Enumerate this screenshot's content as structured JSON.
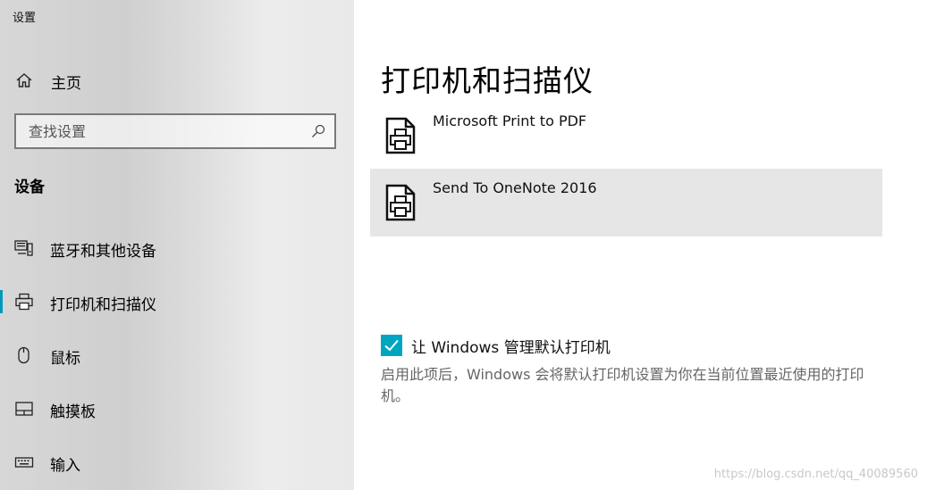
{
  "window": {
    "title": "设置"
  },
  "sidebar": {
    "home_label": "主页",
    "search": {
      "placeholder": "查找设置",
      "value": ""
    },
    "section_title": "设备",
    "items": [
      {
        "label": "蓝牙和其他设备",
        "icon": "bluetooth-devices-icon",
        "active": false
      },
      {
        "label": "打印机和扫描仪",
        "icon": "printer-icon",
        "active": true
      },
      {
        "label": "鼠标",
        "icon": "mouse-icon",
        "active": false
      },
      {
        "label": "触摸板",
        "icon": "touchpad-icon",
        "active": false
      },
      {
        "label": "输入",
        "icon": "keyboard-icon",
        "active": false
      }
    ]
  },
  "main": {
    "title": "打印机和扫描仪",
    "printers": [
      {
        "name": "Microsoft Print to PDF",
        "selected": false
      },
      {
        "name": "Send To OneNote 2016",
        "selected": true
      }
    ],
    "default_printer": {
      "checked": true,
      "label": "让 Windows 管理默认打印机",
      "description": "启用此项后，Windows 会将默认打印机设置为你在当前位置最近使用的打印机。"
    }
  },
  "watermark": "https://blog.csdn.net/qq_40089560",
  "colors": {
    "accent": "#00a6c0",
    "selected_bg": "#e6e6e6",
    "indicator": "#0099bc"
  }
}
